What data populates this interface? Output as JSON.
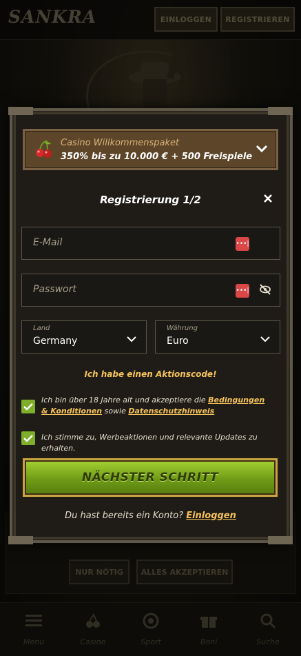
{
  "header": {
    "logo_text": "SANKRA",
    "login_label": "EINLOGGEN",
    "register_label": "REGISTRIEREN"
  },
  "cookie_banner": {
    "only_necessary_label": "NUR NÖTIG",
    "accept_all_label": "ALLES AKZEPTIEREN"
  },
  "bottom_nav": [
    {
      "label": "Menu",
      "icon": "menu-icon"
    },
    {
      "label": "Casino",
      "icon": "cherries-icon"
    },
    {
      "label": "Sport",
      "icon": "soccer-ball-icon"
    },
    {
      "label": "Boni",
      "icon": "gift-icon"
    },
    {
      "label": "Suche",
      "icon": "search-icon"
    }
  ],
  "modal": {
    "welcome": {
      "title": "Casino Willkommenspaket",
      "offer": "350% bis zu 10.000 € + 500 Freispiele",
      "icon": "cherries-icon"
    },
    "title": "Registrierung 1/2",
    "email_placeholder": "E-Mail",
    "password_placeholder": "Passwort",
    "country": {
      "label": "Land",
      "value": "Germany"
    },
    "currency": {
      "label": "Währung",
      "value": "Euro"
    },
    "promo_code_link": "Ich habe einen Aktionscode!",
    "terms": {
      "checked": true,
      "text_before": "Ich bin über 18 Jahre alt und akzeptiere die",
      "terms_link": "Bedingungen & Konditionen",
      "text_mid": "sowie",
      "privacy_link": "Datenschutzhinweis"
    },
    "marketing": {
      "checked": true,
      "text": "Ich stimme zu, Werbeaktionen und relevante Updates zu erhalten."
    },
    "next_button": "NÄCHSTER SCHRITT",
    "have_account": "Du hast bereits ein Konto?",
    "login_link": "Einloggen"
  },
  "colors": {
    "accent_gold": "#f5c35a",
    "cta_green": "#7fae2a",
    "badge_red": "#d94747",
    "modal_bg": "#1f1c17"
  }
}
